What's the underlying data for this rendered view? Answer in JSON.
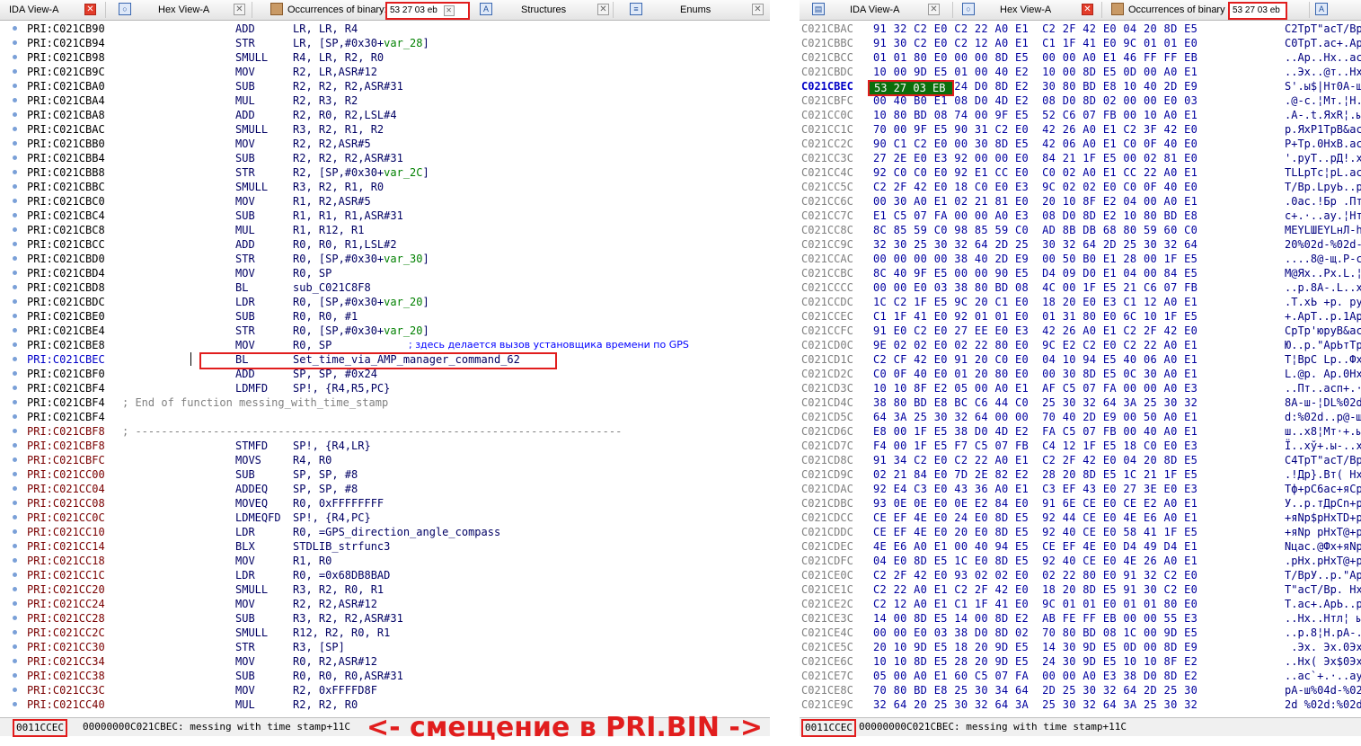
{
  "left": {
    "tabs": [
      {
        "label": "IDA View-A",
        "icon": "ida-view-icon"
      },
      {
        "label": "Hex View-A",
        "icon": "hex-view-icon"
      },
      {
        "label": "Occurrences of binary:",
        "highlight": "53 27 03 eb",
        "icon": "occurrences-icon"
      },
      {
        "label": "Structures",
        "icon": "structures-icon"
      },
      {
        "label": "Enums",
        "icon": "enums-icon"
      }
    ],
    "rows": [
      {
        "addr": "PRI:C021CB90",
        "mn": "ADD",
        "op": "LR, LR, R4"
      },
      {
        "addr": "PRI:C021CB94",
        "mn": "STR",
        "op": "LR, [SP,#0x30+var_28]"
      },
      {
        "addr": "PRI:C021CB98",
        "mn": "SMULL",
        "op": "R4, LR, R2, R0"
      },
      {
        "addr": "PRI:C021CB9C",
        "mn": "MOV",
        "op": "R2, LR,ASR#12"
      },
      {
        "addr": "PRI:C021CBA0",
        "mn": "SUB",
        "op": "R2, R2, R2,ASR#31"
      },
      {
        "addr": "PRI:C021CBA4",
        "mn": "MUL",
        "op": "R2, R3, R2"
      },
      {
        "addr": "PRI:C021CBA8",
        "mn": "ADD",
        "op": "R2, R0, R2,LSL#4"
      },
      {
        "addr": "PRI:C021CBAC",
        "mn": "SMULL",
        "op": "R3, R2, R1, R2"
      },
      {
        "addr": "PRI:C021CBB0",
        "mn": "MOV",
        "op": "R2, R2,ASR#5"
      },
      {
        "addr": "PRI:C021CBB4",
        "mn": "SUB",
        "op": "R2, R2, R2,ASR#31"
      },
      {
        "addr": "PRI:C021CBB8",
        "mn": "STR",
        "op": "R2, [SP,#0x30+var_2C]"
      },
      {
        "addr": "PRI:C021CBBC",
        "mn": "SMULL",
        "op": "R3, R2, R1, R0"
      },
      {
        "addr": "PRI:C021CBC0",
        "mn": "MOV",
        "op": "R1, R2,ASR#5"
      },
      {
        "addr": "PRI:C021CBC4",
        "mn": "SUB",
        "op": "R1, R1, R1,ASR#31"
      },
      {
        "addr": "PRI:C021CBC8",
        "mn": "MUL",
        "op": "R1, R12, R1"
      },
      {
        "addr": "PRI:C021CBCC",
        "mn": "ADD",
        "op": "R0, R0, R1,LSL#2"
      },
      {
        "addr": "PRI:C021CBD0",
        "mn": "STR",
        "op": "R0, [SP,#0x30+var_30]"
      },
      {
        "addr": "PRI:C021CBD4",
        "mn": "MOV",
        "op": "R0, SP"
      },
      {
        "addr": "PRI:C021CBD8",
        "mn": "BL",
        "op": "sub_C021C8F8"
      },
      {
        "addr": "PRI:C021CBDC",
        "mn": "LDR",
        "op": "R0, [SP,#0x30+var_20]"
      },
      {
        "addr": "PRI:C021CBE0",
        "mn": "SUB",
        "op": "R0, R0, #1"
      },
      {
        "addr": "PRI:C021CBE4",
        "mn": "STR",
        "op": "R0, [SP,#0x30+var_20]"
      },
      {
        "addr": "PRI:C021CBE8",
        "mn": "MOV",
        "op": "R0, SP",
        "comment": "; здесь делается вызов установщика времени по GPS"
      },
      {
        "addr": "PRI:C021CBEC",
        "mn": "BL",
        "op": "Set_time_via_AMP_manager_command_62",
        "blue": true,
        "boxed": true
      },
      {
        "addr": "PRI:C021CBF0",
        "mn": "ADD",
        "op": "SP, SP, #0x24"
      },
      {
        "addr": "PRI:C021CBF4",
        "mn": "LDMFD",
        "op": "SP!, {R4,R5,PC}"
      },
      {
        "addr": "PRI:C021CBF4",
        "text": "; End of function messing_with_time_stamp"
      },
      {
        "addr": "PRI:C021CBF4",
        "text": ""
      },
      {
        "addr": "PRI:C021CBF8",
        "text": "; ---------------------------------------------------------------------------",
        "brown": true
      },
      {
        "addr": "PRI:C021CBF8",
        "mn": "STMFD",
        "op": "SP!, {R4,LR}",
        "brown": true
      },
      {
        "addr": "PRI:C021CBFC",
        "mn": "MOVS",
        "op": "R4, R0",
        "brown": true
      },
      {
        "addr": "PRI:C021CC00",
        "mn": "SUB",
        "op": "SP, SP, #8",
        "brown": true
      },
      {
        "addr": "PRI:C021CC04",
        "mn": "ADDEQ",
        "op": "SP, SP, #8",
        "brown": true
      },
      {
        "addr": "PRI:C021CC08",
        "mn": "MOVEQ",
        "op": "R0, 0xFFFFFFFF",
        "brown": true
      },
      {
        "addr": "PRI:C021CC0C",
        "mn": "LDMEQFD",
        "op": "SP!, {R4,PC}",
        "brown": true
      },
      {
        "addr": "PRI:C021CC10",
        "mn": "LDR",
        "op": "R0, =GPS_direction_angle_compass",
        "brown": true
      },
      {
        "addr": "PRI:C021CC14",
        "mn": "BLX",
        "op": "STDLIB_strfunc3",
        "brown": true
      },
      {
        "addr": "PRI:C021CC18",
        "mn": "MOV",
        "op": "R1, R0",
        "brown": true
      },
      {
        "addr": "PRI:C021CC1C",
        "mn": "LDR",
        "op": "R0, =0x68DB8BAD",
        "brown": true
      },
      {
        "addr": "PRI:C021CC20",
        "mn": "SMULL",
        "op": "R3, R2, R0, R1",
        "brown": true
      },
      {
        "addr": "PRI:C021CC24",
        "mn": "MOV",
        "op": "R2, R2,ASR#12",
        "brown": true
      },
      {
        "addr": "PRI:C021CC28",
        "mn": "SUB",
        "op": "R3, R2, R2,ASR#31",
        "brown": true
      },
      {
        "addr": "PRI:C021CC2C",
        "mn": "SMULL",
        "op": "R12, R2, R0, R1",
        "brown": true
      },
      {
        "addr": "PRI:C021CC30",
        "mn": "STR",
        "op": "R3, [SP]",
        "brown": true
      },
      {
        "addr": "PRI:C021CC34",
        "mn": "MOV",
        "op": "R0, R2,ASR#12",
        "brown": true
      },
      {
        "addr": "PRI:C021CC38",
        "mn": "SUB",
        "op": "R0, R0, R0,ASR#31",
        "brown": true
      },
      {
        "addr": "PRI:C021CC3C",
        "mn": "MOV",
        "op": "R2, 0xFFFFD8F",
        "brown": true
      },
      {
        "addr": "PRI:C021CC40",
        "mn": "MUL",
        "op": "R2, R2, R0",
        "brown": true
      }
    ],
    "status_offset": "0011CCEC",
    "status_text": "00000000C021CBEC: messing with time stamp+11C"
  },
  "right": {
    "tabs": [
      {
        "label": "IDA View-A",
        "icon": "ida-view-icon"
      },
      {
        "label": "Hex View-A",
        "icon": "hex-view-icon"
      },
      {
        "label": "Occurrences of binary",
        "highlight": "53 27 03 eb",
        "icon": "occurrences-icon"
      }
    ],
    "rows": [
      {
        "addr": "C021CBAC",
        "bytes": "91 32 C2 E0 C2 22 A0 E1  C2 2F 42 E0 04 20 8D E5",
        "ascii": "С2ТрТ\"асТ/Вр. Нх"
      },
      {
        "addr": "C021CBBC",
        "bytes": "91 30 C2 E0 C2 12 A0 E1  C1 1F 41 E0 9C 01 01 E0",
        "ascii": "С0ТрТ.ас+.АрЬ..р"
      },
      {
        "addr": "C021CBCC",
        "bytes": "01 01 80 E0 00 00 8D E5  00 00 A0 E1 46 FF FF EB",
        "ascii": "..Ар..Нх..асF  ы"
      },
      {
        "addr": "C021CBDC",
        "bytes": "10 00 9D E5 01 00 40 E2  10 00 8D E5 0D 00 A0 E1",
        "ascii": "..Эх..@т..Нх..ас"
      },
      {
        "addr": "C021CBEC",
        "bytes": "53 27 03 EB 24 D0 8D E2  30 80 BD E8 10 40 2D E9",
        "ascii": "S'.ы$|Нт0А-ш.@-щ",
        "cur": true
      },
      {
        "addr": "C021CBFC",
        "bytes": "00 40 B0 E1 08 D0 4D E2  08 D0 8D 02 00 00 E0 03",
        "ascii": ".@-с.¦Мт.¦Н...р."
      },
      {
        "addr": "C021CC0C",
        "bytes": "10 80 BD 08 74 00 9F E5  52 C6 07 FB 00 10 A0 E1",
        "ascii": ".А-.t.ЯхR¦.ы..ас"
      },
      {
        "addr": "C021CC1C",
        "bytes": "70 00 9F E5 90 31 C2 E0  42 26 A0 E1 C2 3F 42 E0",
        "ascii": "p.ЯхР1ТрB&асТ?Вр"
      },
      {
        "addr": "C021CC2C",
        "bytes": "90 C1 C2 E0 00 30 8D E5  42 06 A0 E1 C0 0F 40 E0",
        "ascii": "Р+Тр.0НхB.асL.@р"
      },
      {
        "addr": "C021CC3C",
        "bytes": "27 2E E0 E3 92 00 00 E0  84 21 1F E5 00 02 81 E0",
        "ascii": "'.руТ..рД!.х..Бр"
      },
      {
        "addr": "C021CC4C",
        "bytes": "92 C0 C0 E0 92 E1 CC E0  C0 02 A0 E1 CC 22 A0 E1",
        "ascii": "TLLрТс¦рL.ас¦\"ас"
      },
      {
        "addr": "C021CC5C",
        "bytes": "C2 2F 42 E0 18 C0 E0 E3  9C 02 02 E0 C0 0F 40 E0",
        "ascii": "Т/Вр.LруЬ..рL.@р"
      },
      {
        "addr": "C021CC6C",
        "bytes": "00 30 A0 E1 02 21 81 E0  20 10 8F E2 04 00 A0 E1",
        "ascii": ".0ас.!Бр .Пт..ас"
      },
      {
        "addr": "C021CC7C",
        "bytes": "E1 C5 07 FA 00 00 A0 E3  08 D0 8D E2 10 80 BD E8",
        "ascii": "с+.·..ау.¦Нт.А-ш"
      },
      {
        "addr": "C021CC8C",
        "bytes": "8C 85 59 C0 98 85 59 C0  AD 8B DB 68 80 59 60 C0",
        "ascii": "МЕYLШЕYLнЛ-hАY`L"
      },
      {
        "addr": "C021CC9C",
        "bytes": "32 30 25 30 32 64 2D 25  30 32 64 2D 25 30 32 64",
        "ascii": "20%02d-%02d-%02d"
      },
      {
        "addr": "C021CCAC",
        "bytes": "00 00 00 00 38 40 2D E9  00 50 B0 E1 28 00 1F E5",
        "ascii": "....8@-щ.P-с(..х"
      },
      {
        "addr": "C021CCBC",
        "bytes": "8C 40 9F E5 00 00 90 E5  D4 09 D0 E1 04 00 84 E5",
        "ascii": "М@Ях..Рх.L.¦с..Дх"
      },
      {
        "addr": "C021CCCC",
        "bytes": "00 00 E0 03 38 80 BD 08  4C 00 1F E5 21 C6 07 FB",
        "ascii": "..р.8А-.L..х!¦.ы"
      },
      {
        "addr": "C021CCDC",
        "bytes": "1C C2 1F E5 9C 20 C1 E0  18 20 E0 E3 C1 12 A0 E1",
        "ascii": ".Т.хЬ +р. ру+.ас"
      },
      {
        "addr": "C021CCEC",
        "bytes": "C1 1F 41 E0 92 01 01 E0  01 31 80 E0 6C 10 1F E5",
        "ascii": "+.АрТ..р.1Ар1..х"
      },
      {
        "addr": "C021CCFC",
        "bytes": "91 E0 C2 E0 27 EE E0 E3  42 26 A0 E1 C2 2F 42 E0",
        "ascii": "СрТр'юруB&асТ/Вр"
      },
      {
        "addr": "C021CD0C",
        "bytes": "9E 02 02 E0 02 22 80 E0  9C E2 C2 E0 C2 22 A0 E1",
        "ascii": "Ю..р.\"АрЬтТр\"ас"
      },
      {
        "addr": "C021CD1C",
        "bytes": "C2 CF 42 E0 91 20 C0 E0  04 10 94 E5 40 06 A0 E1",
        "ascii": "Т¦ВрС Lр..Фх@.ас"
      },
      {
        "addr": "C021CD2C",
        "bytes": "C0 0F 40 E0 01 20 80 E0  00 30 8D E5 0C 30 A0 E1",
        "ascii": "L.@р. Ар.0Нх.0ас"
      },
      {
        "addr": "C021CD3C",
        "bytes": "10 10 8F E2 05 00 A0 E1  AF C5 07 FA 00 00 A0 E3",
        "ascii": "..Пт..асп+.·..ау"
      },
      {
        "addr": "C021CD4C",
        "bytes": "38 80 BD E8 BC C6 44 C0  25 30 32 64 3A 25 30 32",
        "ascii": "8А-ш-¦DL%02d:%02"
      },
      {
        "addr": "C021CD5C",
        "bytes": "64 3A 25 30 32 64 00 00  70 40 2D E9 00 50 A0 E1",
        "ascii": "d:%02d..p@-щ.Рас"
      },
      {
        "addr": "C021CD6C",
        "bytes": "E8 00 1F E5 38 D0 4D E2  FA C5 07 FB 00 40 A0 E1",
        "ascii": "ш..х8¦Мт·+.ы.@ас"
      },
      {
        "addr": "C021CD7C",
        "bytes": "F4 00 1F E5 F7 C5 07 FB  C4 12 1F E5 18 C0 E0 E3",
        "ascii": "Ї..хў+.ы-..х.Lру"
      },
      {
        "addr": "C021CD8C",
        "bytes": "91 34 C2 E0 C2 22 A0 E1  C2 2F 42 E0 04 20 8D E5",
        "ascii": "С4ТрТ\"асТ/Вр. Нх"
      },
      {
        "addr": "C021CD9C",
        "bytes": "02 21 84 E0 7D 2E 82 E2  28 20 8D E5 1C 21 1F E5",
        "ascii": ".!Др}.Вт( Нх.!.х"
      },
      {
        "addr": "C021CDAC",
        "bytes": "92 E4 C3 E0 43 36 A0 E1  C3 EF 43 E0 27 3E E0 E3",
        "ascii": "Тф+рC6ас+яCр'>ру"
      },
      {
        "addr": "C021CDBC",
        "bytes": "93 0E 0E E0 0E E2 84 E0  91 6E CE E0 CE E2 A0 E1",
        "ascii": "У..р.тДрСn+р+тас"
      },
      {
        "addr": "C021CDCC",
        "bytes": "CE EF 4E E0 24 E0 8D E5  92 44 CE E0 4E E6 A0 E1",
        "ascii": "+яNр$рНхТD+рNцас"
      },
      {
        "addr": "C021CDDC",
        "bytes": "CE EF 4E E0 20 E0 8D E5  92 40 CE E0 58 41 1F E5",
        "ascii": "+яNр рНхТ@+рXA.х"
      },
      {
        "addr": "C021CDEC",
        "bytes": "4E E6 A0 E1 00 40 94 E5  CE EF 4E E0 D4 49 D4 E1",
        "ascii": "Nцас.@Фх+яNрLILс"
      },
      {
        "addr": "C021CDFC",
        "bytes": "04 E0 8D E5 1C E0 8D E5  92 40 CE E0 4E 26 A0 E1",
        "ascii": ".рНх.рНхТ@+рN&ас"
      },
      {
        "addr": "C021CE0C",
        "bytes": "C2 2F 42 E0 93 02 02 E0  02 22 80 E0 91 32 C2 E0",
        "ascii": "Т/ВрУ..р.\"АрС2Тр"
      },
      {
        "addr": "C021CE1C",
        "bytes": "C2 22 A0 E1 C2 2F 42 E0  18 20 8D E5 91 30 C2 E0",
        "ascii": "Т\"асТ/Вр. НхС0Тр"
      },
      {
        "addr": "C021CE2C",
        "bytes": "C2 12 A0 E1 C1 1F 41 E0  9C 01 01 E0 01 01 80 E0",
        "ascii": "Т.ас+.АрЬ..р..Ар"
      },
      {
        "addr": "C021CE3C",
        "bytes": "14 00 8D E5 14 00 8D E2  AB FE FF EB 00 00 55 E3",
        "ascii": "..Нх..Нтл¦ ы..Uу"
      },
      {
        "addr": "C021CE4C",
        "bytes": "00 00 E0 03 38 D0 8D 02  70 80 BD 08 1C 00 9D E5",
        "ascii": "..р.8¦Н.pА-...Эх"
      },
      {
        "addr": "C021CE5C",
        "bytes": "20 10 9D E5 18 20 9D E5  14 30 9D E5 0D 00 8D E9",
        "ascii": " .Эх. Эх.0Эх..Нщ"
      },
      {
        "addr": "C021CE6C",
        "bytes": "10 10 8D E5 28 20 9D E5  24 30 9D E5 10 10 8F E2",
        "ascii": "..Нх( Эх$0Эх..Пт"
      },
      {
        "addr": "C021CE7C",
        "bytes": "05 00 A0 E1 60 C5 07 FA  00 00 A0 E3 38 D0 8D E2",
        "ascii": "..ас`+.·..ау8¦Нт"
      },
      {
        "addr": "C021CE8C",
        "bytes": "70 80 BD E8 25 30 34 64  2D 25 30 32 64 2D 25 30",
        "ascii": "pА-ш%04d-%02d-%0"
      },
      {
        "addr": "C021CE9C",
        "bytes": "32 64 20 25 30 32 64 3A  25 30 32 64 3A 25 30 32",
        "ascii": "2d %02d:%02d:%02"
      }
    ],
    "status_offset": "0011CCEC",
    "status_text": "00000000C021CBEC: messing with time stamp+11C"
  },
  "banner": "<- смещение в PRI.BIN ->",
  "highlight_bytes": "53 27 03 EB",
  "colors": {
    "accent": "#e11d1d",
    "match_bg": "#0b6e0b"
  }
}
